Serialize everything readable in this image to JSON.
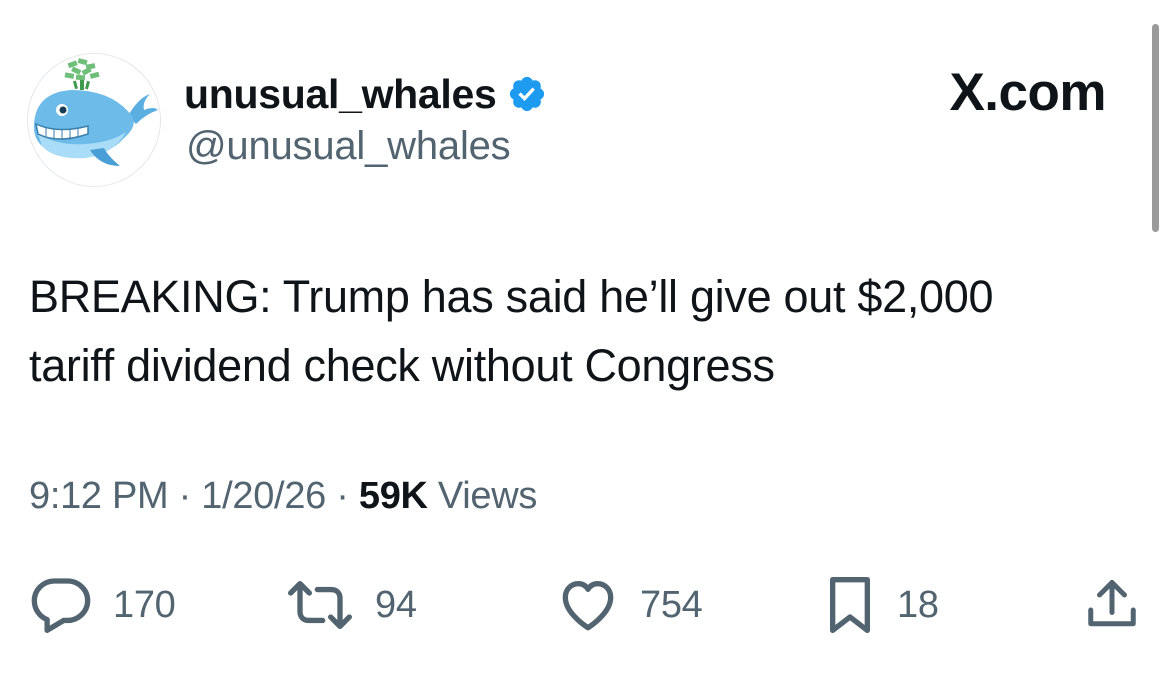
{
  "author": {
    "display_name": "unusual_whales",
    "handle": "@unusual_whales",
    "avatar_icon": "whale-avatar-icon",
    "verified_icon": "verified-badge-icon",
    "verified_color": "#1d9bf0"
  },
  "brand": {
    "label": "X.com"
  },
  "tweet": {
    "lines": [
      "BREAKING: Trump has said he’ll give out $2,000",
      "tariff dividend check without Congress"
    ]
  },
  "meta": {
    "time": "9:12 PM",
    "separator": " · ",
    "date": "1/20/26",
    "views_count": "59K",
    "views_label": " Views"
  },
  "actions": {
    "reply": {
      "icon": "reply-icon",
      "count": "170"
    },
    "retweet": {
      "icon": "retweet-icon",
      "count": "94"
    },
    "like": {
      "icon": "heart-icon",
      "count": "754"
    },
    "bookmark": {
      "icon": "bookmark-icon",
      "count": "18"
    },
    "share": {
      "icon": "share-icon"
    }
  },
  "colors": {
    "text_primary": "#0f1419",
    "text_secondary": "#536471",
    "accent": "#1d9bf0"
  }
}
